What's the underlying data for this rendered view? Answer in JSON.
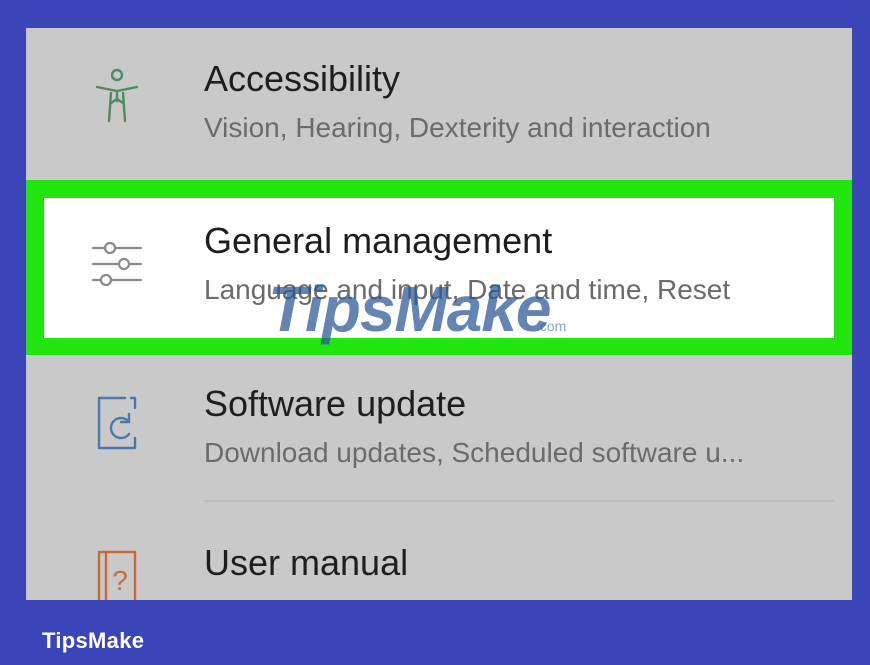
{
  "settings": {
    "items": [
      {
        "title": "Accessibility",
        "subtitle": "Vision, Hearing, Dexterity and interaction",
        "icon": "accessibility-icon",
        "icon_color": "#4f8a62"
      },
      {
        "title": "General management",
        "subtitle": "Language and input, Date and time, Reset",
        "icon": "sliders-icon",
        "icon_color": "#8a8a8a",
        "highlighted": true,
        "highlight_color": "#22e40e"
      },
      {
        "title": "Software update",
        "subtitle": "Download updates, Scheduled software u...",
        "icon": "software-update-icon",
        "icon_color": "#4a78a8"
      },
      {
        "title": "User manual",
        "icon": "user-manual-icon",
        "icon_color": "#c96a3a"
      }
    ]
  },
  "watermark": {
    "text": "TipsMake",
    "suffix": ".com"
  },
  "footer": {
    "brand": "TipsMake",
    "background": "#3b45b8"
  }
}
